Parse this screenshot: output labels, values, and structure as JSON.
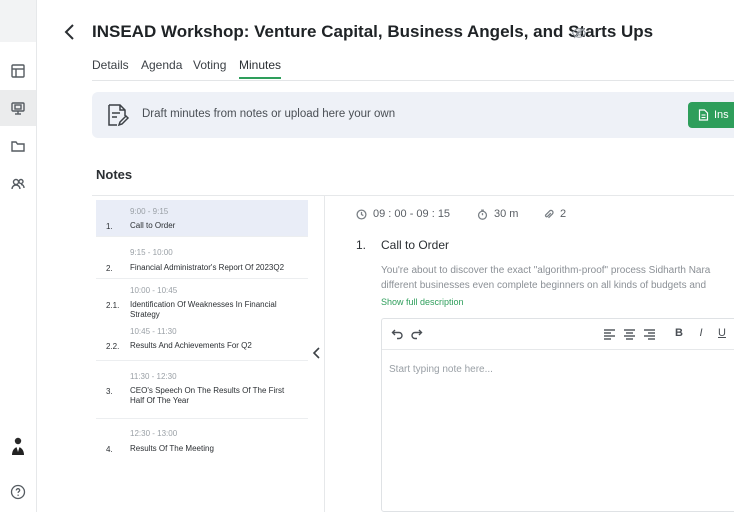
{
  "page": {
    "title": "INSEAD Workshop: Venture Capital, Business Angels, and Starts Ups"
  },
  "tabs": [
    {
      "label": "Details"
    },
    {
      "label": "Agenda"
    },
    {
      "label": "Voting"
    },
    {
      "label": "Minutes",
      "active": true
    }
  ],
  "banner": {
    "text": "Draft minutes from notes or upload here your own",
    "button_label": "Ins"
  },
  "notes": {
    "title": "Notes"
  },
  "agenda": [
    {
      "time": "9:00 - 9:15",
      "num": "1.",
      "label": "Call to Order"
    },
    {
      "time": "9:15 - 10:00",
      "num": "2.",
      "label": "Financial Administrator's Report Of 2023Q2"
    },
    {
      "time": "10:00 - 10:45",
      "num": "2.1.",
      "label": "Identification Of Weaknesses In Financial Strategy"
    },
    {
      "time": "10:45 - 11:30",
      "num": "2.2.",
      "label": "Results And Achievements For Q2"
    },
    {
      "time": "11:30 - 12:30",
      "num": "3.",
      "label": "CEO's Speech On The Results Of The First Half Of The Year"
    },
    {
      "time": "12:30 - 13:00",
      "num": "4.",
      "label": "Results Of The Meeting"
    }
  ],
  "detail": {
    "time_range": "09 : 00 - 09 : 15",
    "duration": "30 m",
    "attachments": "2",
    "num": "1.",
    "title": "Call to Order",
    "desc_line1": "You're about to discover the exact \"algorithm-proof\" process Sidharth Nara",
    "desc_line2": "different businesses even complete beginners on all kinds of budgets and",
    "show_full": "Show full description"
  },
  "editor": {
    "placeholder": "Start typing note here...",
    "bold": "B",
    "italic": "I",
    "underline": "U"
  },
  "colors": {
    "accent": "#2e9e5b",
    "banner_bg": "#eef1f7",
    "active_item_bg": "#e9edf7"
  }
}
